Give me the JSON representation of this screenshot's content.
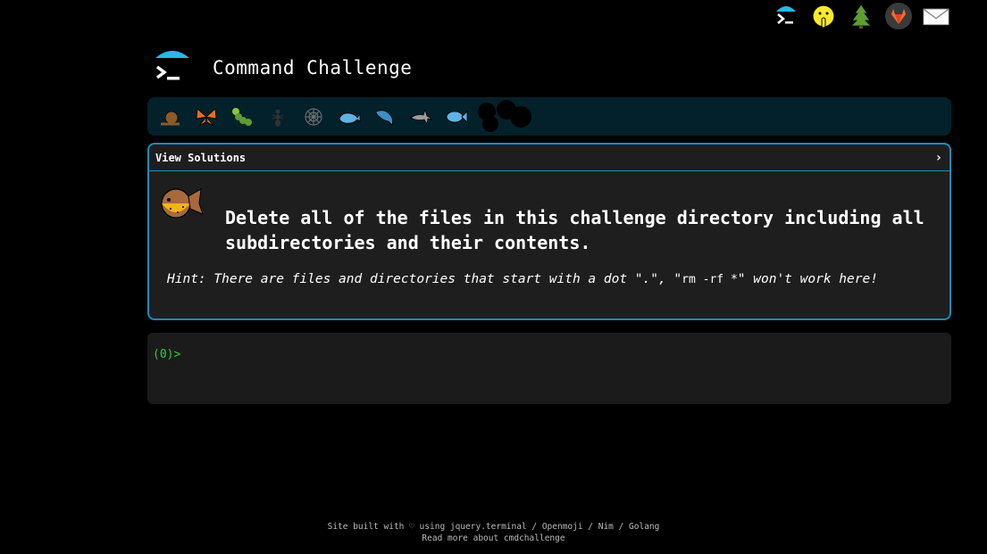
{
  "header": {
    "title": "Command Challenge",
    "logo_icon": "terminal-umbrella-icon"
  },
  "top_icons": [
    {
      "name": "terminal-umbrella-icon"
    },
    {
      "name": "shushing-face-icon"
    },
    {
      "name": "tree-icon"
    },
    {
      "name": "gitlab-icon"
    },
    {
      "name": "mail-icon"
    }
  ],
  "strip": {
    "items": [
      "snail-icon",
      "butterfly-icon",
      "caterpillar-icon",
      "ant-icon",
      "web-icon",
      "whale-icon",
      "dolphin-icon",
      "shark-icon",
      "fish-icon",
      "blob-icon"
    ]
  },
  "card": {
    "view_solutions": "View Solutions",
    "chevron": "›",
    "icon": "blowfish-icon",
    "task": "Delete all of the files in this challenge directory including all subdirectories and their contents.",
    "hint_prefix": "Hint: There are files and directories that start with a dot \".\", \"",
    "hint_code": "rm -rf *",
    "hint_suffix": "\" won't work here!"
  },
  "terminal": {
    "prompt": "(0)>"
  },
  "footer": {
    "line1": "Site built with ♡ using jquery.terminal / Openmoji / Nim / Golang",
    "line2": "Read more about cmdchallenge"
  },
  "colors": {
    "accent": "#1a8cb8",
    "strip_bg": "#03212a",
    "prompt": "#2ecc40"
  }
}
